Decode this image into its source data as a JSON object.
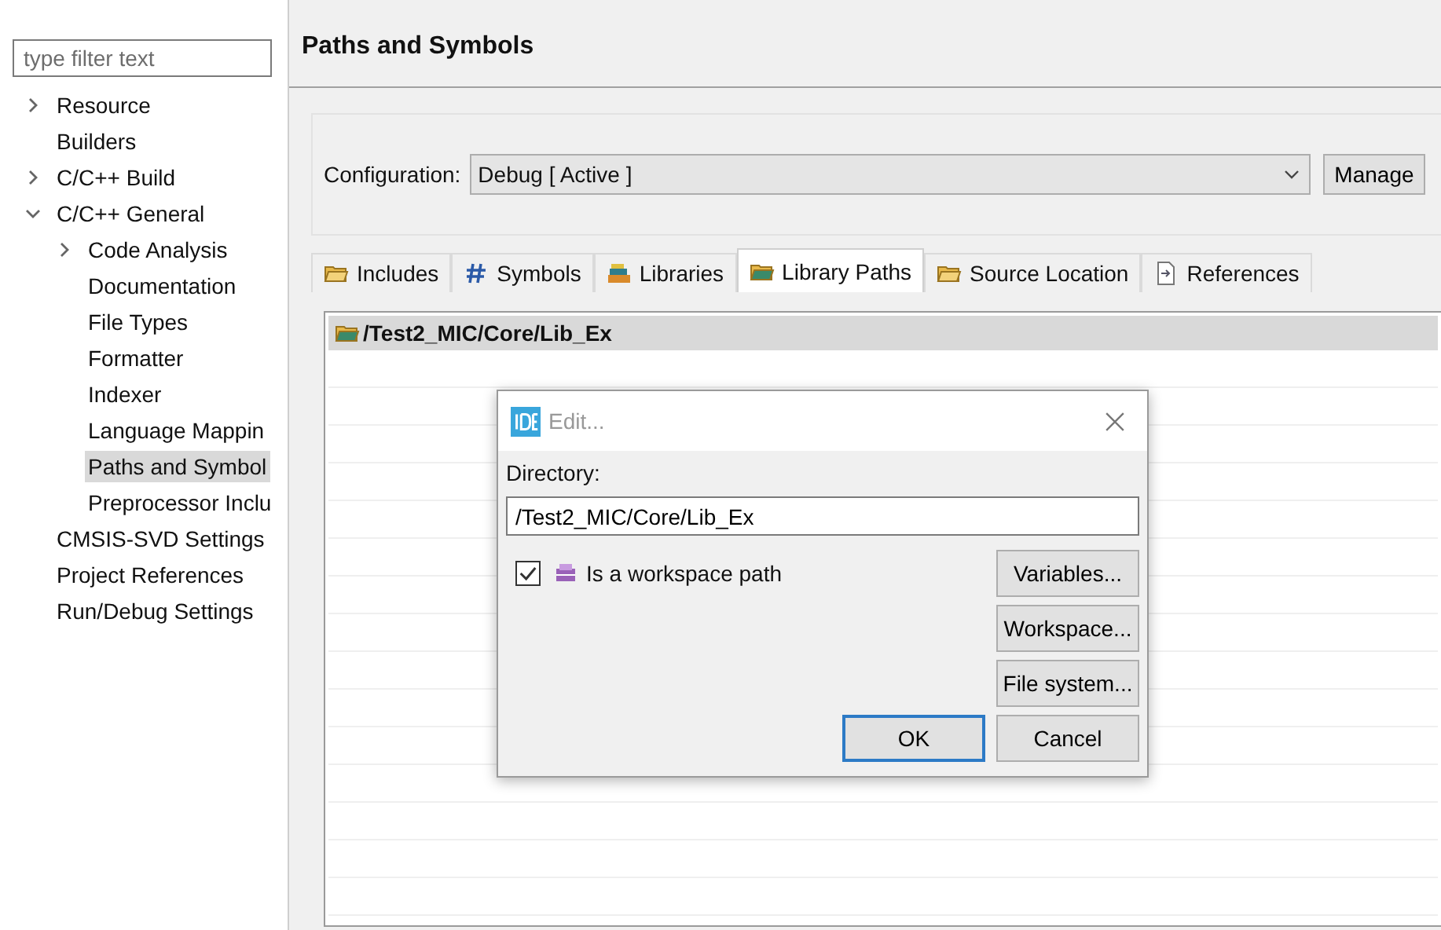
{
  "sidebar": {
    "filter": {
      "placeholder": "type filter text"
    },
    "tree": [
      {
        "label": "Resource",
        "expanded": false,
        "selected": false
      },
      {
        "label": "Builders",
        "selected": false
      },
      {
        "label": "C/C++ Build",
        "expanded": false,
        "selected": false
      },
      {
        "label": "C/C++ General",
        "expanded": true,
        "selected": false,
        "children": [
          {
            "label": "Code Analysis",
            "expanded": false,
            "selected": false
          },
          {
            "label": "Documentation",
            "selected": false
          },
          {
            "label": "File Types",
            "selected": false
          },
          {
            "label": "Formatter",
            "selected": false
          },
          {
            "label": "Indexer",
            "selected": false
          },
          {
            "label": "Language Mappin",
            "selected": false
          },
          {
            "label": "Paths and Symbol",
            "selected": true
          },
          {
            "label": "Preprocessor Inclu",
            "selected": false
          }
        ]
      },
      {
        "label": "CMSIS-SVD Settings",
        "selected": false
      },
      {
        "label": "Project References",
        "selected": false
      },
      {
        "label": "Run/Debug Settings",
        "selected": false
      }
    ]
  },
  "page": {
    "title": "Paths and Symbols",
    "configuration": {
      "label": "Configuration:",
      "value": "Debug  [ Active ]",
      "button": "Manage"
    },
    "tabs": [
      {
        "label": "Includes",
        "selected": false
      },
      {
        "label": "Symbols",
        "selected": false
      },
      {
        "label": "Libraries",
        "selected": false
      },
      {
        "label": "Library Paths",
        "selected": true
      },
      {
        "label": "Source Location",
        "selected": false
      },
      {
        "label": "References",
        "selected": false
      }
    ],
    "table": {
      "rows": [
        {
          "path": "/Test2_MIC/Core/Lib_Ex",
          "selected": true
        }
      ]
    }
  },
  "dialog": {
    "title": "Edit...",
    "directory_label": "Directory:",
    "directory_value": "/Test2_MIC/Core/Lib_Ex",
    "workspace_checkbox": {
      "label": "Is a workspace path",
      "checked": true
    },
    "side_buttons": [
      "Variables...",
      "Workspace...",
      "File system..."
    ],
    "buttons": [
      {
        "label": "OK",
        "default": true
      },
      {
        "label": "Cancel",
        "default": false
      }
    ]
  }
}
